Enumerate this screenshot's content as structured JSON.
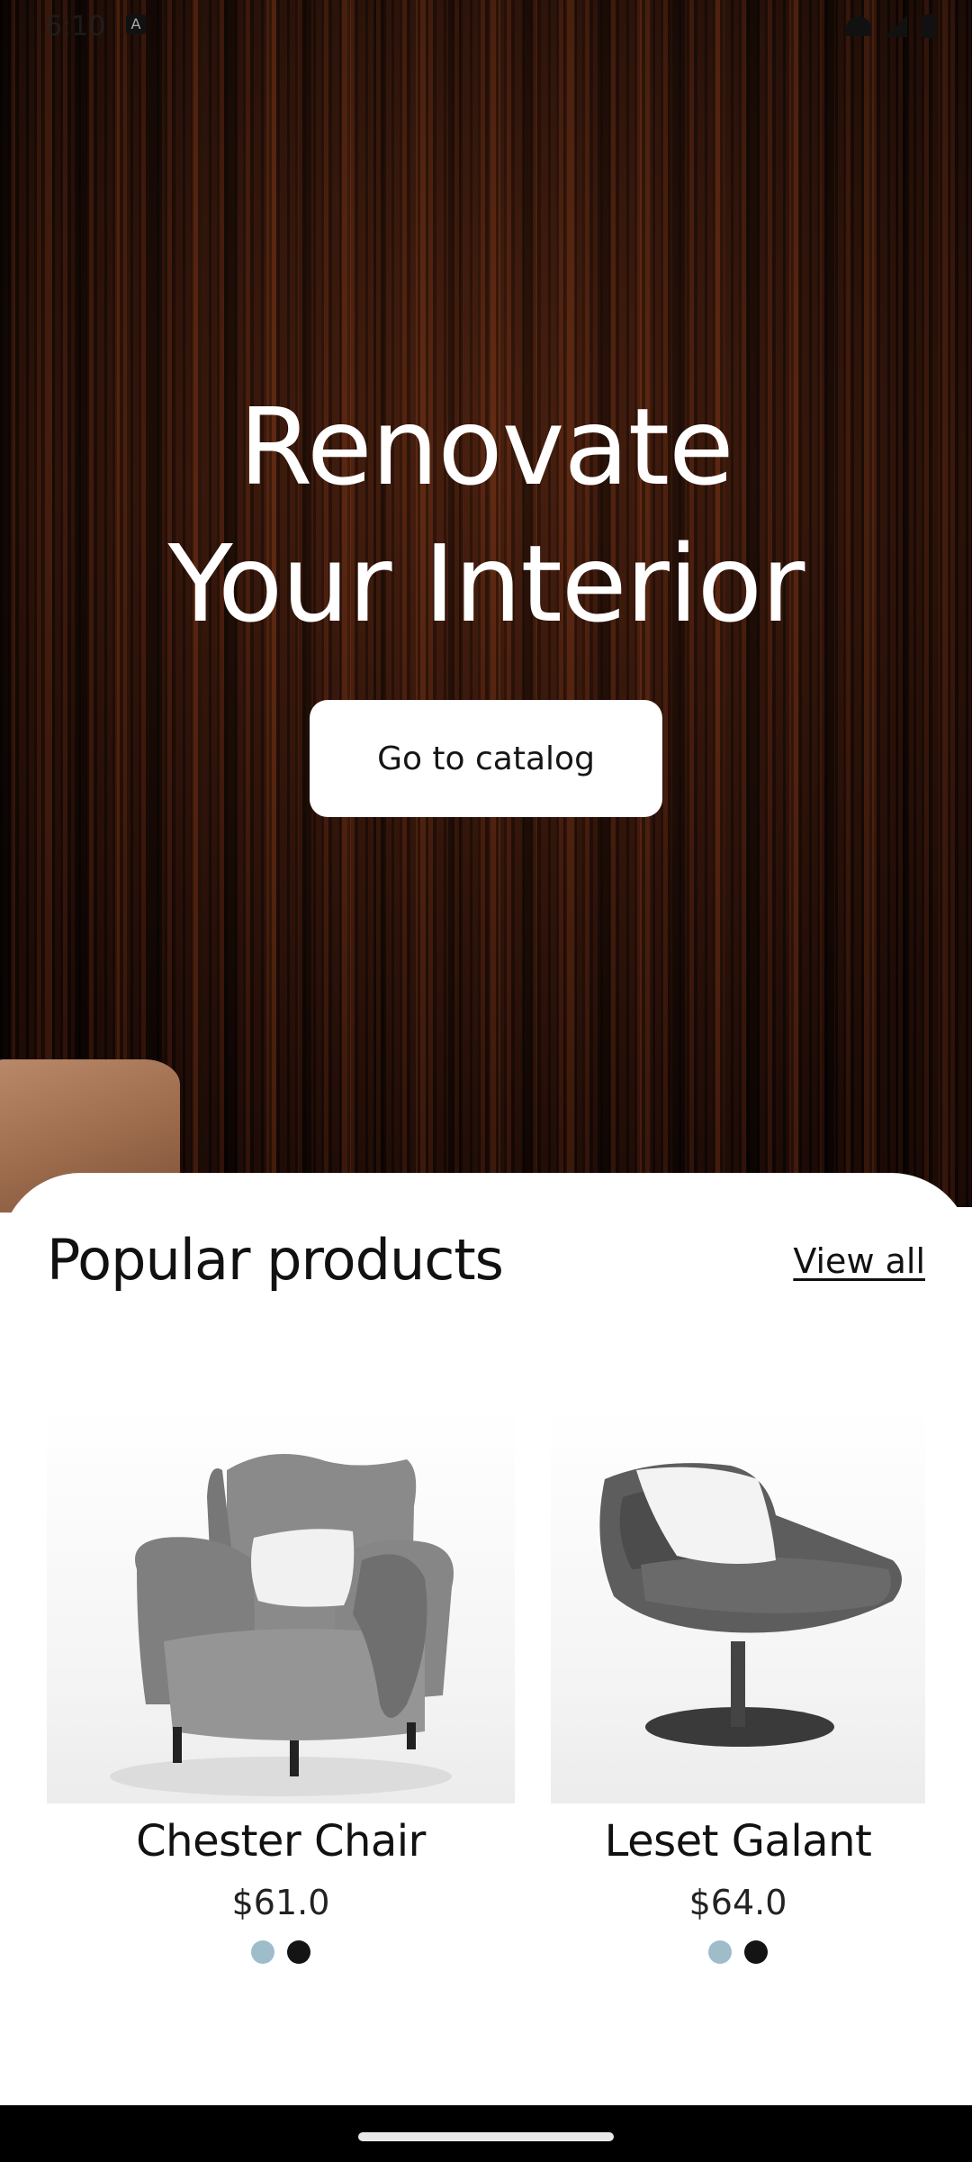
{
  "status_bar": {
    "time": "6:10",
    "notification_icon": "app-notification-icon",
    "icons": [
      "wifi-icon",
      "signal-icon",
      "battery-icon"
    ]
  },
  "hero": {
    "title_line1": "Renovate",
    "title_line2": "Your Interior",
    "cta_label": "Go to catalog"
  },
  "popular": {
    "title": "Popular products",
    "view_all_label": "View all",
    "products": [
      {
        "name": "Chester Chair",
        "price": "$61.0",
        "image_icon": "wingback-armchair-image",
        "colors": [
          "#9fbccb",
          "#141414"
        ]
      },
      {
        "name": "Leset Galant",
        "price": "$64.0",
        "image_icon": "swivel-lounge-chair-image",
        "colors": [
          "#9fbccb",
          "#141414"
        ]
      }
    ]
  },
  "colors": {
    "cta_bg": "#ffffff",
    "sheet_bg": "#ffffff",
    "text": "#111111",
    "wood_dark": "#2a120a"
  }
}
